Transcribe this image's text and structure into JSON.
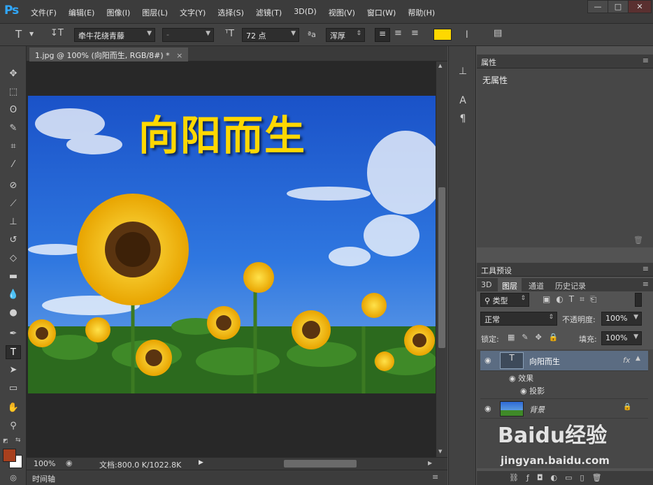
{
  "app": {
    "logo": "Ps"
  },
  "menu": [
    "文件(F)",
    "编辑(E)",
    "图像(I)",
    "图层(L)",
    "文字(Y)",
    "选择(S)",
    "滤镜(T)",
    "3D(D)",
    "视图(V)",
    "窗口(W)",
    "帮助(H)"
  ],
  "window_controls": {
    "minimize": "—",
    "maximize": "□",
    "close": "✕"
  },
  "options": {
    "font_family": "牵牛花绕青藤",
    "font_style": "-",
    "font_size": "72 点",
    "aa_label": "ªa",
    "aa_mode": "浑厚",
    "text_color": "#ffd800"
  },
  "document": {
    "tab_title": "1.jpg @ 100% (向阳而生, RGB/8#) *",
    "tab_close": "×",
    "overlay_text": "向阳而生",
    "zoom": "100%",
    "doc_info": "文档:800.0 K/1022.8K",
    "timeline_label": "时间轴"
  },
  "properties": {
    "title": "属性",
    "content": "无属性"
  },
  "tool_presets": {
    "title": "工具预设"
  },
  "layers_panel": {
    "tabs": [
      "3D",
      "图层",
      "通道",
      "历史记录"
    ],
    "active_tab": "图层",
    "filter": "类型",
    "blend_mode": "正常",
    "opacity_label": "不透明度:",
    "opacity": "100%",
    "lock_label": "锁定:",
    "fill_label": "填充:",
    "fill": "100%",
    "layers": [
      {
        "name": "向阳而生",
        "fx": "fx",
        "effects_label": "效果",
        "effect": "投影"
      },
      {
        "name": "背景"
      }
    ]
  },
  "colors": {
    "foreground": "#a8401e",
    "background": "#ffffff",
    "accent": "#30a8ff"
  },
  "watermark": {
    "brand": "Baidu经验",
    "url": "jingyan.baidu.com"
  }
}
